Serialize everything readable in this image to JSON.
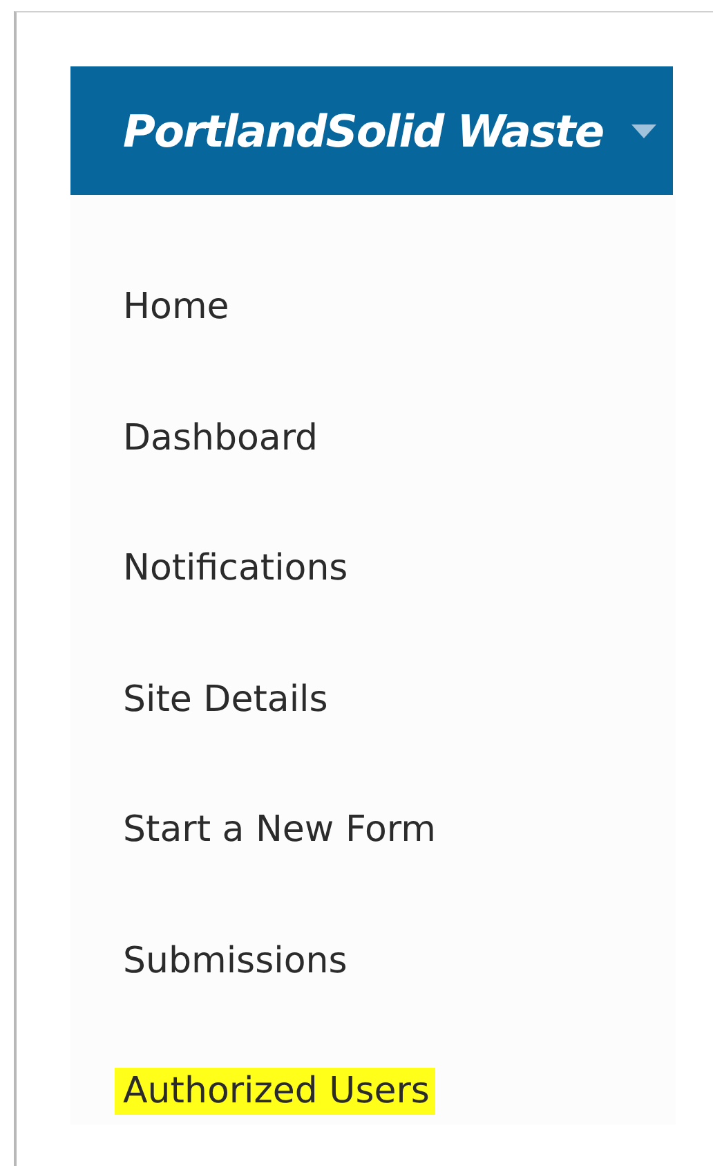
{
  "header": {
    "title": "PortlandSolid Waste"
  },
  "menu": [
    {
      "label": "Home",
      "highlighted": false
    },
    {
      "label": "Dashboard",
      "highlighted": false
    },
    {
      "label": "Notifications",
      "highlighted": false
    },
    {
      "label": "Site Details",
      "highlighted": false
    },
    {
      "label": "Start a New Form",
      "highlighted": false
    },
    {
      "label": "Submissions",
      "highlighted": false
    },
    {
      "label": "Authorized Users",
      "highlighted": true
    }
  ]
}
